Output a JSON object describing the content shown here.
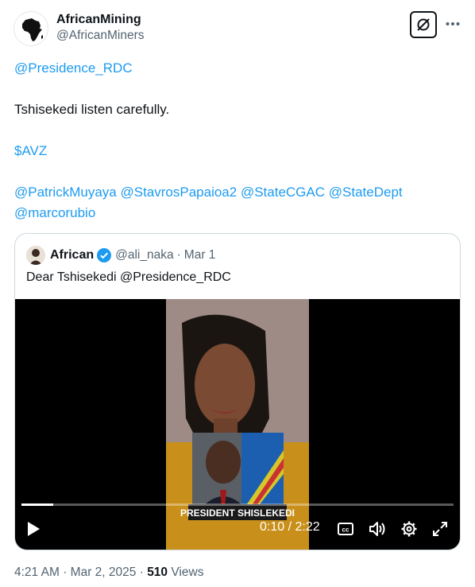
{
  "author": {
    "display_name": "AfricanMining",
    "handle": "@AfricanMiners",
    "avatar_icon": "africa-map-icon"
  },
  "actions": {
    "grok_icon": "grok-icon",
    "more_icon": "more-icon"
  },
  "tweet": {
    "mention_1": "@Presidence_RDC",
    "line_2": "Tshisekedi listen carefully.",
    "cashtag": "$AVZ",
    "mentions": [
      "@PatrickMuyaya",
      "@StavrosPapaioa2",
      "@StateCGAC",
      "@StateDept",
      "@marcorubio"
    ]
  },
  "quote": {
    "display_name": "African",
    "verified_icon": "verified-badge-icon",
    "handle": "@ali_naka",
    "separator": "·",
    "date": "Mar 1",
    "text_prefix": "Dear Tshisekedi",
    "text_mention": "@Presidence_RDC",
    "video": {
      "caption": "PRESIDENT SHISLEKEDI",
      "elapsed": "0:10",
      "duration": "2:22",
      "time_sep": "/",
      "progress": 0.074,
      "controls": [
        "play-icon",
        "captions-icon",
        "volume-icon",
        "settings-icon",
        "fullscreen-icon"
      ]
    }
  },
  "footer": {
    "time": "4:21 AM",
    "sep1": "·",
    "date": "Mar 2, 2025",
    "sep2": "·",
    "views_count": "510",
    "views_label": "Views"
  },
  "colors": {
    "link": "#1d9bf0",
    "muted": "#536471",
    "text": "#0f1419",
    "border": "#cfd9de"
  }
}
